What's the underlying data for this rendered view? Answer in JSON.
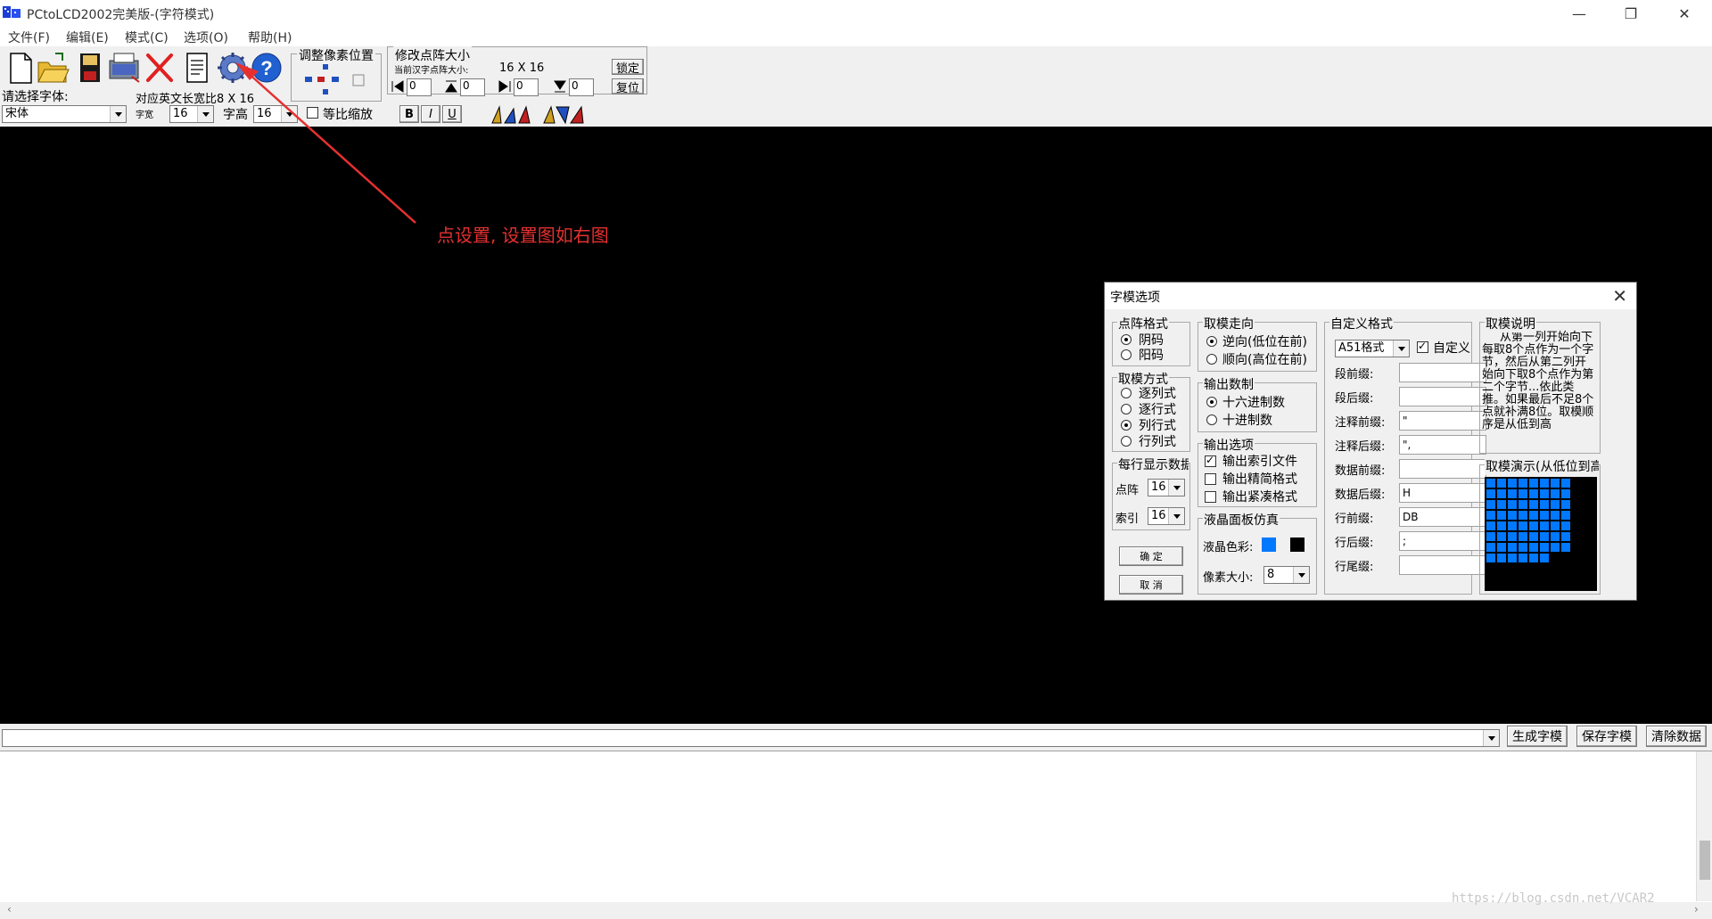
{
  "window": {
    "title": "PCtoLCD2002完美版-(字符模式)",
    "controls": {
      "minimize": "—",
      "restore": "❐",
      "close": "✕"
    }
  },
  "menu": {
    "items": [
      "文件(F)",
      "编辑(E)",
      "模式(C)",
      "选项(O)",
      "帮助(H)"
    ]
  },
  "toolbar": {
    "font_label": "请选择字体:",
    "font_value": "宋体",
    "ratio_label": "对应英文长宽比8 X 16",
    "width_label": "字宽",
    "width_value": "16",
    "height_label": "字高",
    "height_value": "16",
    "proportional_label": "等比缩放",
    "adjust_pixel_title": "调整像素位置",
    "resize_title": "修改点阵大小",
    "current_size_label": "当前汉字点阵大小:",
    "current_size_value": "16 X 16",
    "lock_label": "锁定",
    "reset_label": "复位",
    "spin_values": [
      "0",
      "0",
      "0",
      "0"
    ],
    "bold": "B",
    "italic": "I",
    "underline": "U"
  },
  "annotation": "点设置, 设置图如右图",
  "dialog": {
    "title": "字模选项",
    "dot_format": {
      "title": "点阵格式",
      "options": [
        "阴码",
        "阳码"
      ],
      "selected": 0
    },
    "scan_mode": {
      "title": "取模方式",
      "options": [
        "逐列式",
        "逐行式",
        "列行式",
        "行列式"
      ],
      "selected": 2
    },
    "per_line": {
      "title": "每行显示数据",
      "dot_label": "点阵",
      "dot_value": "16",
      "index_label": "索引",
      "index_value": "16"
    },
    "ok_label": "确 定",
    "cancel_label": "取 消",
    "direction": {
      "title": "取模走向",
      "options": [
        "逆向(低位在前)",
        "顺向(高位在前)"
      ],
      "selected": 0
    },
    "radix": {
      "title": "输出数制",
      "options": [
        "十六进制数",
        "十进制数"
      ],
      "selected": 0
    },
    "output_opts": {
      "title": "输出选项",
      "options": [
        "输出索引文件",
        "输出精简格式",
        "输出紧凑格式"
      ],
      "checked": [
        true,
        false,
        false
      ]
    },
    "lcd": {
      "title": "液晶面板仿真",
      "color_label": "液晶色彩:",
      "pixel_label": "像素大小:",
      "pixel_value": "8",
      "fg_color": "#0078ff",
      "bg_color": "#000000"
    },
    "custom": {
      "title": "自定义格式",
      "format_value": "A51格式",
      "custom_check_label": "自定义格式",
      "fields": [
        {
          "label": "段前缀:",
          "value": ""
        },
        {
          "label": "段后缀:",
          "value": ""
        },
        {
          "label": "注释前缀:",
          "value": "\""
        },
        {
          "label": "注释后缀:",
          "value": "\","
        },
        {
          "label": "数据前缀:",
          "value": ""
        },
        {
          "label": "数据后缀:",
          "value": "H"
        },
        {
          "label": "行前缀:",
          "value": "DB"
        },
        {
          "label": "行后缀:",
          "value": ";"
        },
        {
          "label": "行尾缀:",
          "value": ""
        }
      ]
    },
    "explain": {
      "title": "取模说明",
      "text": "从第一列开始向下每取8个点作为一个字节，然后从第二列开始向下取8个点作为第二个字节...依此类推。如果最后不足8个点就补满8位。取模顺序是从低到高"
    },
    "demo": {
      "title": "取模演示(从低位到高位)"
    }
  },
  "bottom": {
    "generate_label": "生成字模",
    "save_label": "保存字模",
    "clear_label": "清除数据"
  },
  "watermark": "https://blog.csdn.net/VCAR2"
}
